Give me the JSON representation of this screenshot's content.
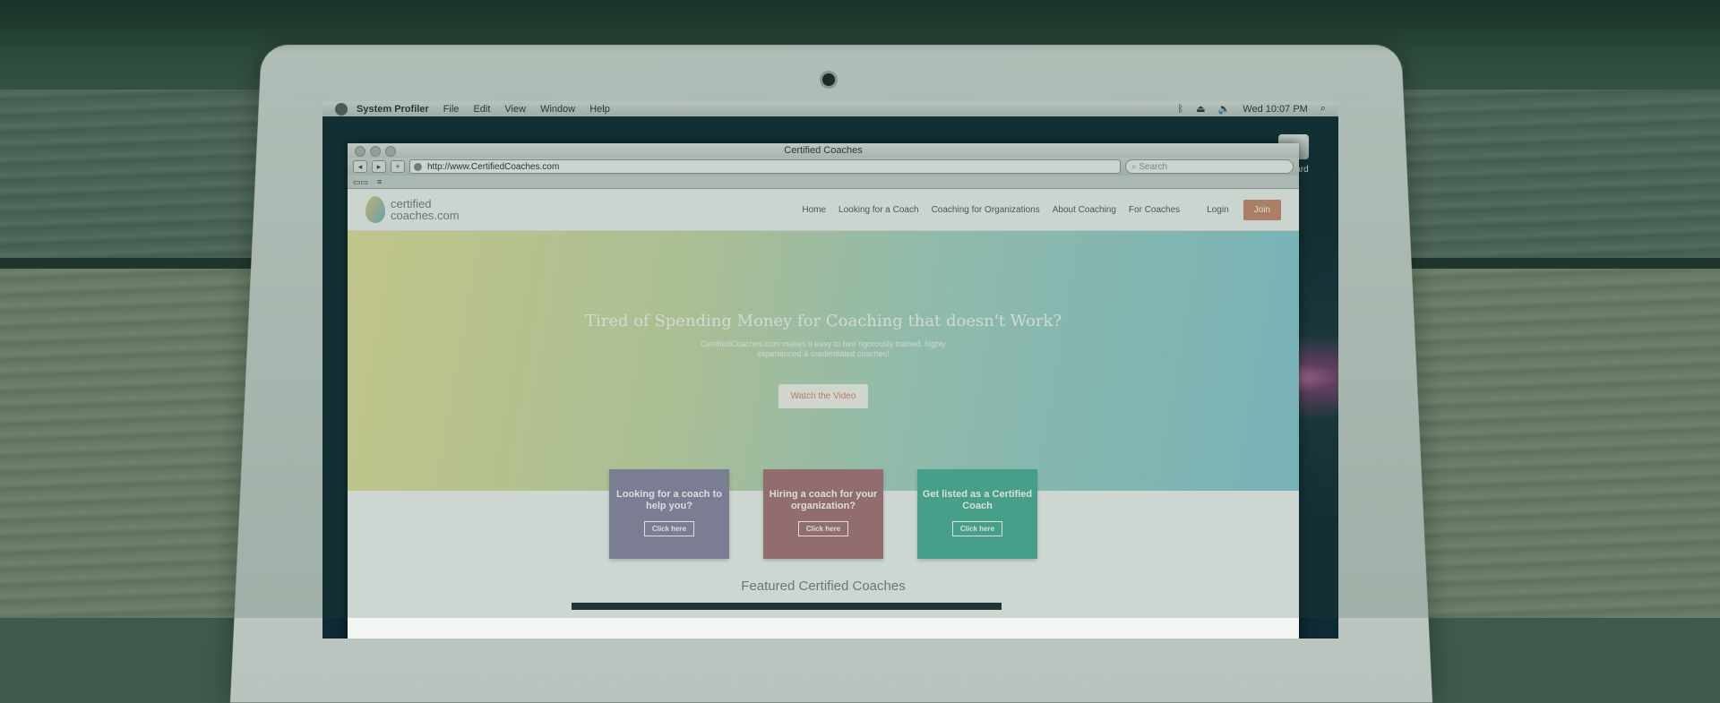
{
  "menubar": {
    "app": "System Profiler",
    "items": [
      "File",
      "Edit",
      "View",
      "Window",
      "Help"
    ],
    "clock": "Wed 10:07 PM"
  },
  "desktop": {
    "drive_label": "leopard"
  },
  "browser": {
    "title": "Certified Coaches",
    "url": "http://www.CertifiedCoaches.com",
    "search_placeholder": "Search"
  },
  "site": {
    "logo_line1": "certified",
    "logo_line2": "coaches.com",
    "nav": [
      "Home",
      "Looking for a Coach",
      "Coaching for Organizations",
      "About Coaching",
      "For Coaches"
    ],
    "login": "Login",
    "join": "Join",
    "hero_title": "Tired of Spending Money for Coaching that doesn't Work?",
    "hero_sub": "CertifiedCoaches.com makes it easy to hire rigorously trained, highly experienced & credentialed coaches!",
    "video_btn": "Watch the Video",
    "cards": [
      {
        "title": "Looking for a coach to help you?",
        "button": "Click here"
      },
      {
        "title": "Hiring a coach for your organization?",
        "button": "Click here"
      },
      {
        "title": "Get listed as a Certified Coach",
        "button": "Click here"
      }
    ],
    "featured": "Featured Certified Coaches"
  }
}
